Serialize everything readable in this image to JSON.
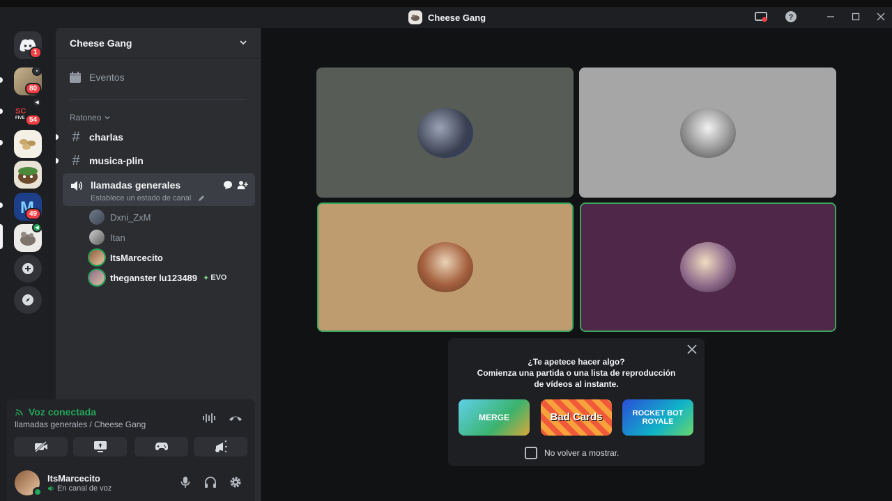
{
  "window": {
    "title": "Cheese Gang"
  },
  "guilds": [
    {
      "name": "discord-home",
      "badge": "1"
    },
    {
      "name": "server-1",
      "badge": "80"
    },
    {
      "name": "server-2",
      "badge": "54"
    },
    {
      "name": "server-3",
      "badge": ""
    },
    {
      "name": "server-4",
      "badge": ""
    },
    {
      "name": "server-5",
      "badge": "49"
    },
    {
      "name": "cheese-gang",
      "badge": ""
    }
  ],
  "sidebar": {
    "server_name": "Cheese Gang",
    "events_label": "Eventos",
    "category": "Ratoneo",
    "channels": [
      {
        "name": "charlas"
      },
      {
        "name": "musica-plin"
      }
    ],
    "voice_channel": {
      "name": "llamadas generales",
      "status_placeholder": "Establece un estado de canal",
      "users": [
        {
          "name": "Dxni_ZxM"
        },
        {
          "name": "Itan"
        },
        {
          "name": "ItsMarcecito"
        },
        {
          "name": "theganster lu123489",
          "tag": "EVO"
        }
      ]
    }
  },
  "voice_panel": {
    "title": "Voz conectada",
    "subtitle": "llamadas generales / Cheese Gang"
  },
  "user": {
    "name": "ItsMarcecito",
    "status": "En canal de voz"
  },
  "activity": {
    "line1": "¿Te apetece hacer algo?",
    "line2": "Comienza una partida o una lista de reproducción",
    "line3": "de vídeos al instante.",
    "games": [
      "MERGE",
      "Bad Cards",
      "ROCKET BOT ROYALE"
    ],
    "checkbox_label": "No volver a mostrar."
  },
  "colors": {
    "accent_green": "#23a55a",
    "tile1": "#575c57",
    "tile2": "#a6a6a6",
    "tile3": "#bf9c6f",
    "tile4": "#4f2748"
  }
}
